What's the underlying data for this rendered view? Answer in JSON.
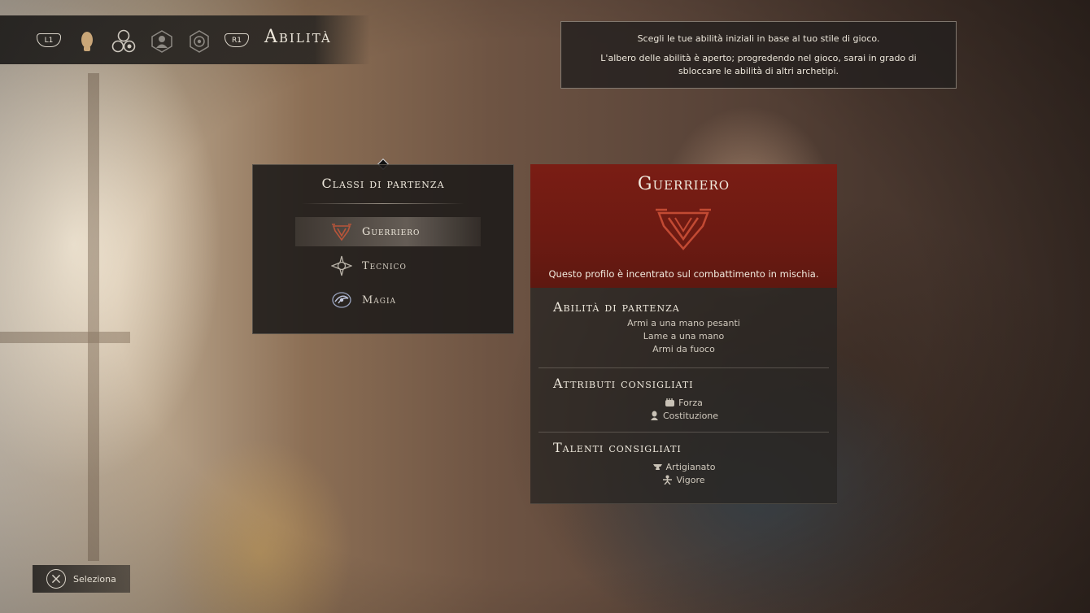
{
  "header": {
    "left_bumper": "L1",
    "right_bumper": "R1",
    "title": "Abilità",
    "tabs": [
      {
        "icon": "character-head-icon",
        "active": true
      },
      {
        "icon": "skills-orbs-icon",
        "active": false
      },
      {
        "icon": "portrait-icon",
        "active": false
      },
      {
        "icon": "gear-icon",
        "active": false
      }
    ]
  },
  "hint": {
    "line1": "Scegli le tue abilità iniziali in base al tuo stile di gioco.",
    "line2": "L'albero delle abilità è aperto; progredendo nel gioco, sarai in grado di sbloccare le abilità di altri archetipi."
  },
  "classes": {
    "title": "Classi di partenza",
    "items": [
      {
        "label": "Guerriero",
        "icon": "warrior-crest-icon",
        "selected": true
      },
      {
        "label": "Tecnico",
        "icon": "gear-star-icon",
        "selected": false
      },
      {
        "label": "Magia",
        "icon": "arcane-swirl-icon",
        "selected": false
      }
    ]
  },
  "detail": {
    "title": "Guerriero",
    "emblem": "warrior-crest-icon",
    "description": "Questo profilo è incentrato sul combattimento in mischia.",
    "starting_skills": {
      "title": "Abilità di partenza",
      "items": [
        "Armi a una mano pesanti",
        "Lame a una mano",
        "Armi da fuoco"
      ]
    },
    "recommended_attributes": {
      "title": "Attributi consigliati",
      "items": [
        {
          "label": "Forza",
          "icon": "fist-icon"
        },
        {
          "label": "Costituzione",
          "icon": "body-icon"
        }
      ]
    },
    "recommended_talents": {
      "title": "Talenti consigliati",
      "items": [
        {
          "label": "Artigianato",
          "icon": "anvil-icon"
        },
        {
          "label": "Vigore",
          "icon": "vigor-icon"
        }
      ]
    }
  },
  "prompt": {
    "button": "cross-button-icon",
    "label": "Seleziona"
  },
  "colors": {
    "accent_red": "#7a1d14",
    "panel_dark": "#1c1a19",
    "text_light": "#eee8dc"
  }
}
